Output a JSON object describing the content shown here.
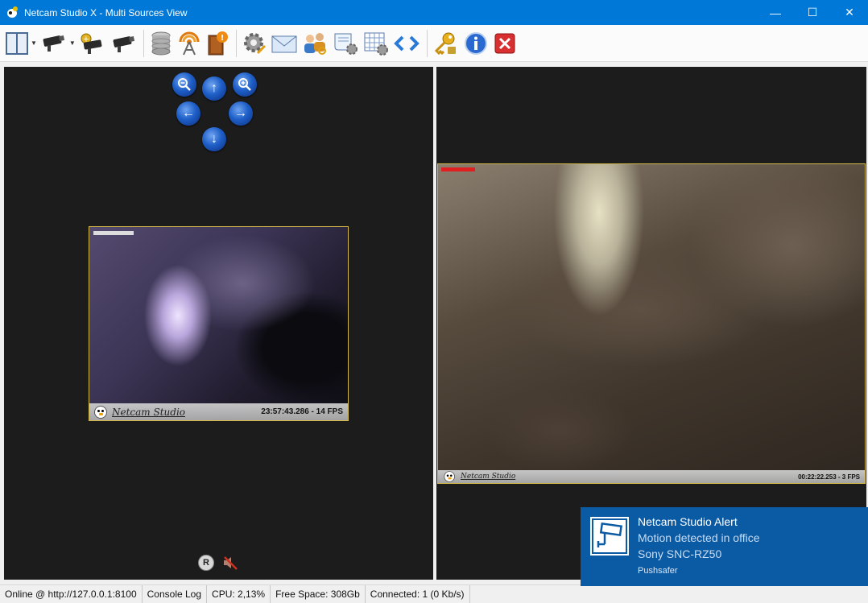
{
  "window": {
    "title": "Netcam Studio X - Multi Sources View",
    "minimize_glyph": "—",
    "maximize_glyph": "☐",
    "close_glyph": "✕"
  },
  "toolbar": {
    "items": [
      "layout-icon",
      "camera-icon",
      "add-camera-icon",
      "cameras-icon",
      "database-icon",
      "broadcast-icon",
      "event-log-icon",
      "settings-icon",
      "mail-icon",
      "users-icon",
      "script-icon",
      "schedule-icon",
      "code-icon",
      "license-key-icon",
      "info-icon",
      "exit-icon"
    ]
  },
  "ptz": {
    "zoom_out": "zoom-out-icon",
    "zoom_in": "zoom-in-icon",
    "up": "↑",
    "down": "↓",
    "left": "←",
    "right": "→"
  },
  "camera1": {
    "brand": "Netcam Studio",
    "timestamp": "23:57:43.286 - 14 FPS",
    "level_color": "#dcdcdc"
  },
  "camera2": {
    "brand": "Netcam Studio",
    "timestamp": "00:22:22.253 - 3 FPS",
    "level_color": "#e02020"
  },
  "controls": {
    "record_label": "R",
    "mute_icon": "speaker-muted-icon"
  },
  "statusbar": {
    "online": "Online @ http://127.0.0.1:8100",
    "console": "Console Log",
    "cpu": "CPU: 2,13%",
    "free_space": "Free Space: 308Gb",
    "connected": "Connected: 1 (0 Kb/s)"
  },
  "toast": {
    "title": "Netcam Studio Alert",
    "line1": "Motion detected in office",
    "line2": "Sony SNC-RZ50",
    "source": "Pushsafer",
    "bg_color": "#0b5aa4"
  }
}
